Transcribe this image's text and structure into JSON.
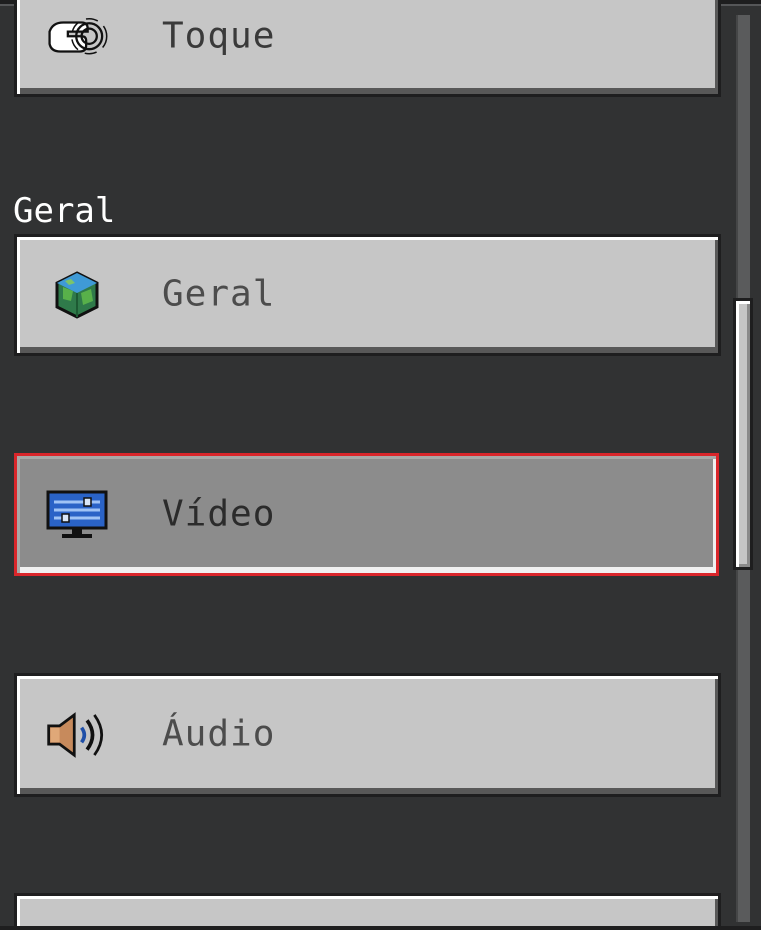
{
  "buttons": {
    "touch": {
      "label": "Toque",
      "icon": "touch-icon"
    },
    "general": {
      "label": "Geral",
      "icon": "globe-cube-icon"
    },
    "video": {
      "label": "Vídeo",
      "icon": "monitor-sliders-icon",
      "selected": true
    },
    "audio": {
      "label": "Áudio",
      "icon": "speaker-icon"
    }
  },
  "section": {
    "general_title": "Geral"
  },
  "colors": {
    "background": "#313233",
    "button_face": "#c6c6c6",
    "button_selected": "#8c8c8c",
    "focus_outline": "#d9262b"
  }
}
